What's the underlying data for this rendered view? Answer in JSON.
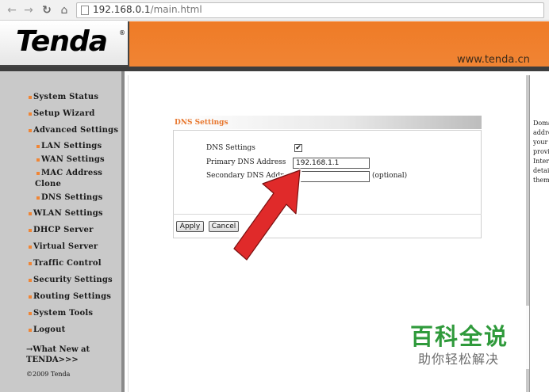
{
  "browser": {
    "url_host": "192.168.0.1",
    "url_path": "/main.html"
  },
  "header": {
    "logo": "Tenda",
    "logo_mark": "®",
    "site_url": "www.tenda.cn"
  },
  "sidebar": {
    "items": [
      {
        "label": "System Status"
      },
      {
        "label": "Setup Wizard"
      },
      {
        "label": "Advanced Settings"
      },
      {
        "label": "LAN Settings"
      },
      {
        "label": "WAN Settings"
      },
      {
        "label": "MAC Address"
      },
      {
        "label": "Clone"
      },
      {
        "label": "DNS Settings"
      },
      {
        "label": "WLAN Settings"
      },
      {
        "label": "DHCP Server"
      },
      {
        "label": "Virtual Server"
      },
      {
        "label": "Traffic Control"
      },
      {
        "label": "Security Settings"
      },
      {
        "label": "Routing Settings"
      },
      {
        "label": "System Tools"
      },
      {
        "label": "Logout"
      }
    ],
    "whats_new_line1": "→What New at",
    "whats_new_line2": "TENDA>>>",
    "copyright": "©2009 Tenda"
  },
  "dns_panel": {
    "title": "DNS Settings",
    "dns_settings_label": "DNS Settings",
    "dns_enabled_mark": "✔",
    "primary_label": "Primary DNS Address",
    "primary_value": "192.168.1.1",
    "secondary_label": "Secondary DNS Address",
    "secondary_value": "",
    "optional_label": "(optional)",
    "apply_label": "Apply",
    "cancel_label": "Cancel"
  },
  "help_panel": {
    "lines": [
      "Doma",
      "addre",
      "your",
      "provi",
      "Intern",
      "detail",
      "them."
    ]
  },
  "watermark": {
    "title": "百科全说",
    "subtitle": "助你轻松解决"
  },
  "colors": {
    "brand_orange": "#f08535",
    "arrow_red": "#e02a2a",
    "watermark_green": "#2f9a3b"
  }
}
